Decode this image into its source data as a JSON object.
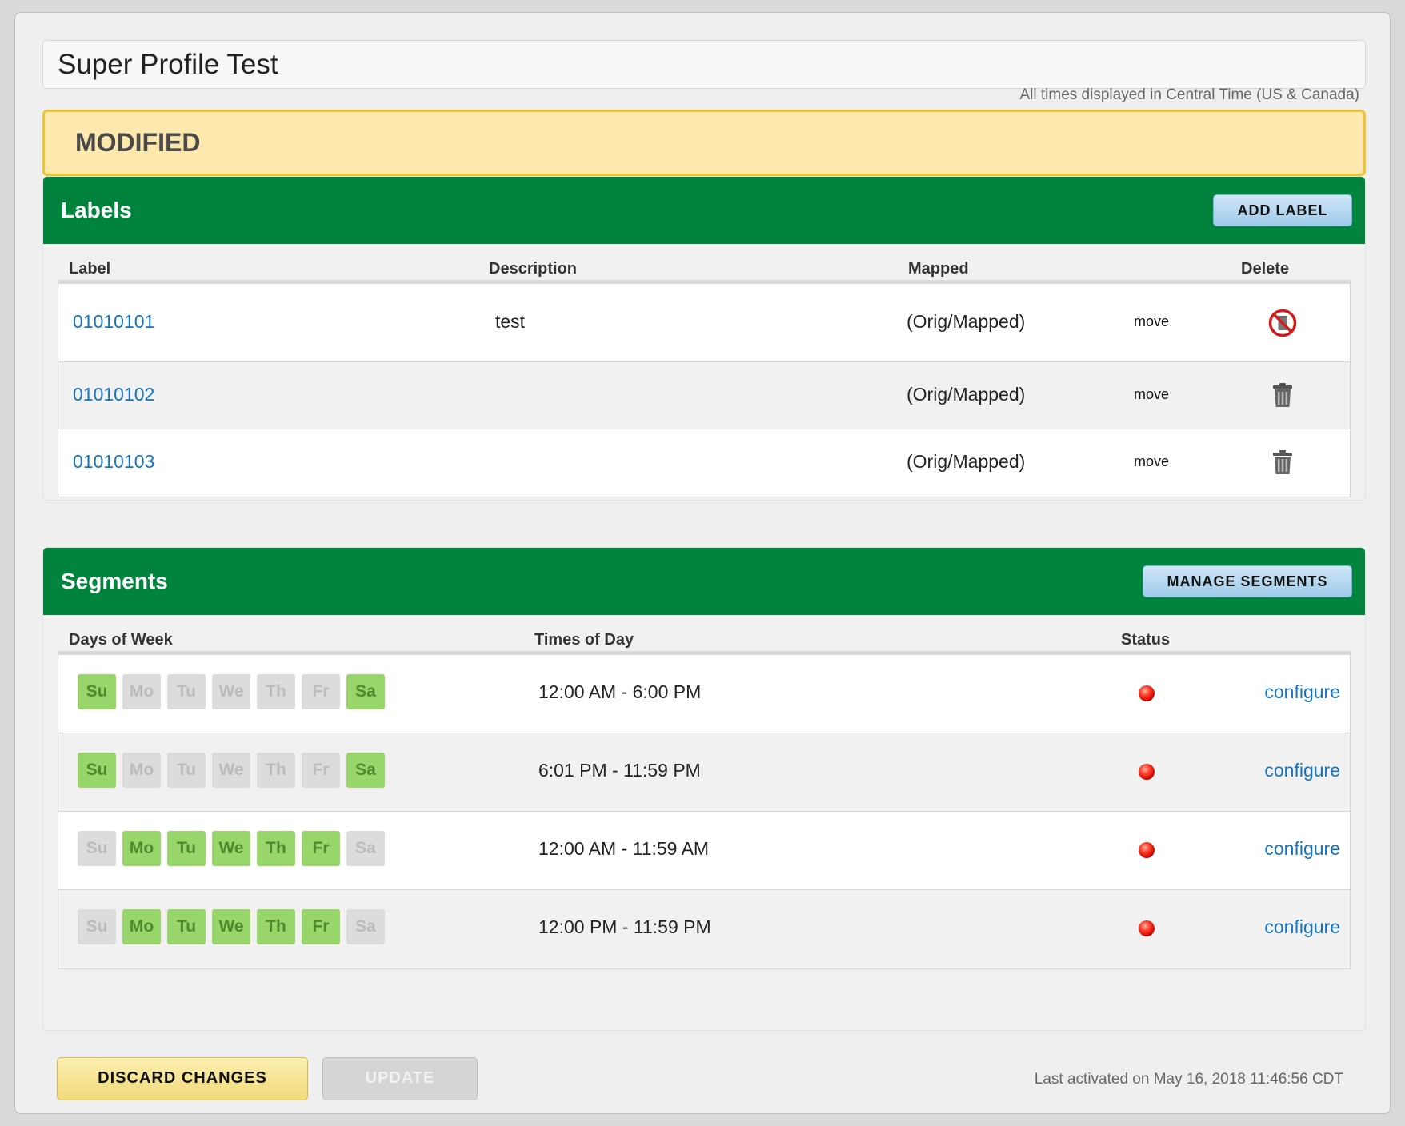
{
  "profile": {
    "title": "Super Profile Test",
    "timezone_note": "All times displayed in Central Time (US & Canada)",
    "status_banner": "MODIFIED"
  },
  "labels": {
    "title": "Labels",
    "add_button": "ADD LABEL",
    "columns": [
      "Label",
      "Description",
      "Mapped",
      "Delete"
    ],
    "rows": [
      {
        "label": "01010101",
        "description": "test",
        "mapped": "(Orig/Mapped)",
        "move": "move",
        "delete_icon": "no-delete-icon"
      },
      {
        "label": "01010102",
        "description": "",
        "mapped": "(Orig/Mapped)",
        "move": "move",
        "delete_icon": "trash-icon"
      },
      {
        "label": "01010103",
        "description": "",
        "mapped": "(Orig/Mapped)",
        "move": "move",
        "delete_icon": "trash-icon"
      }
    ]
  },
  "segments": {
    "title": "Segments",
    "manage_button": "MANAGE SEGMENTS",
    "columns": [
      "Days of Week",
      "Times of Day",
      "Status"
    ],
    "day_names": [
      "Su",
      "Mo",
      "Tu",
      "We",
      "Th",
      "Fr",
      "Sa"
    ],
    "rows": [
      {
        "days_active": [
          true,
          false,
          false,
          false,
          false,
          false,
          true
        ],
        "times": "12:00 AM - 6:00 PM",
        "status": "red",
        "action": "configure"
      },
      {
        "days_active": [
          true,
          false,
          false,
          false,
          false,
          false,
          true
        ],
        "times": "6:01 PM - 11:59 PM",
        "status": "red",
        "action": "configure"
      },
      {
        "days_active": [
          false,
          true,
          true,
          true,
          true,
          true,
          false
        ],
        "times": "12:00 AM - 11:59 AM",
        "status": "red",
        "action": "configure"
      },
      {
        "days_active": [
          false,
          true,
          true,
          true,
          true,
          true,
          false
        ],
        "times": "12:00 PM - 11:59 PM",
        "status": "red",
        "action": "configure"
      }
    ]
  },
  "footer": {
    "discard_button": "DISCARD CHANGES",
    "update_button": "UPDATE",
    "last_activated": "Last activated on May 16, 2018 11:46:56 CDT"
  },
  "colors": {
    "header_green": "#00843d",
    "link_blue": "#1674bd",
    "day_active": "#98d56a",
    "banner_yellow": "#fde9ae"
  }
}
